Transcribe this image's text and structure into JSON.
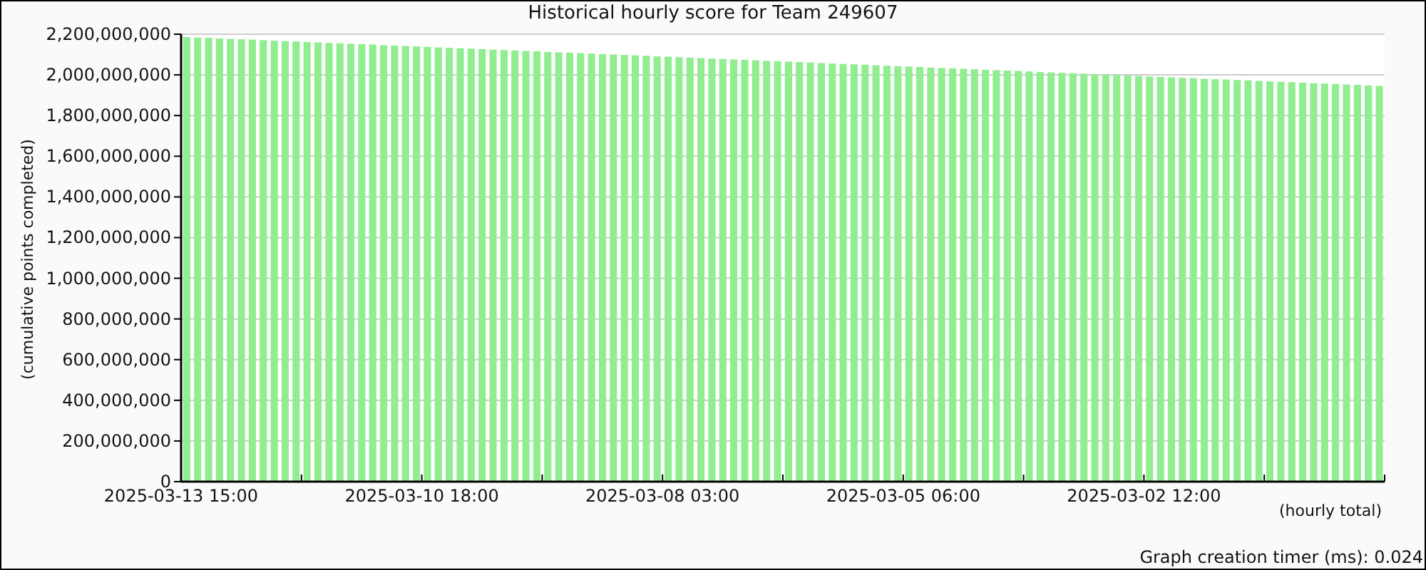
{
  "title": "Historical hourly score for Team 249607",
  "chart_data": {
    "type": "bar",
    "ylabel": "(cumulative points completed)",
    "xlabel": "(hourly total)",
    "ylim": [
      0,
      2200000000
    ],
    "yticks": [
      {
        "value": 0,
        "label": "0"
      },
      {
        "value": 200000000,
        "label": "200,000,000"
      },
      {
        "value": 400000000,
        "label": "400,000,000"
      },
      {
        "value": 600000000,
        "label": "600,000,000"
      },
      {
        "value": 800000000,
        "label": "800,000,000"
      },
      {
        "value": 1000000000,
        "label": "1,000,000,000"
      },
      {
        "value": 1200000000,
        "label": "1,200,000,000"
      },
      {
        "value": 1400000000,
        "label": "1,400,000,000"
      },
      {
        "value": 1600000000,
        "label": "1,600,000,000"
      },
      {
        "value": 1800000000,
        "label": "1,800,000,000"
      },
      {
        "value": 2000000000,
        "label": "2,000,000,000"
      },
      {
        "value": 2200000000,
        "label": "2,200,000,000"
      }
    ],
    "grid": true,
    "categories": [
      "2025-03-13 15:00",
      null,
      null,
      null,
      null,
      null,
      null,
      null,
      null,
      null,
      null,
      null,
      null,
      null,
      null,
      null,
      null,
      null,
      null,
      null,
      null,
      null,
      "2025-03-10 18:00",
      null,
      null,
      null,
      null,
      null,
      null,
      null,
      null,
      null,
      null,
      null,
      null,
      null,
      null,
      null,
      null,
      null,
      null,
      null,
      null,
      null,
      "2025-03-08 03:00",
      null,
      null,
      null,
      null,
      null,
      null,
      null,
      null,
      null,
      null,
      null,
      null,
      null,
      null,
      null,
      null,
      null,
      null,
      null,
      null,
      null,
      "2025-03-05 06:00",
      null,
      null,
      null,
      null,
      null,
      null,
      null,
      null,
      null,
      null,
      null,
      null,
      null,
      null,
      null,
      null,
      null,
      null,
      null,
      null,
      null,
      "2025-03-02 12:00",
      null,
      null,
      null,
      null,
      null,
      null,
      null,
      null,
      null,
      null,
      null,
      null,
      null,
      null,
      null,
      null,
      null,
      null,
      null,
      null,
      null
    ],
    "series": [
      {
        "color": "#90ee90",
        "values": [
          2186000000,
          2184000000,
          2182000000,
          2179000000,
          2177000000,
          2175000000,
          2173000000,
          2171000000,
          2168000000,
          2166000000,
          2164000000,
          2162000000,
          2160000000,
          2157000000,
          2155000000,
          2153000000,
          2151000000,
          2149000000,
          2146000000,
          2144000000,
          2142000000,
          2140000000,
          2138000000,
          2135000000,
          2133000000,
          2131000000,
          2129000000,
          2127000000,
          2124000000,
          2122000000,
          2120000000,
          2118000000,
          2116000000,
          2113000000,
          2111000000,
          2109000000,
          2107000000,
          2105000000,
          2102000000,
          2100000000,
          2098000000,
          2096000000,
          2094000000,
          2091000000,
          2089000000,
          2087000000,
          2085000000,
          2083000000,
          2080000000,
          2078000000,
          2076000000,
          2074000000,
          2072000000,
          2069000000,
          2067000000,
          2065000000,
          2063000000,
          2061000000,
          2058000000,
          2056000000,
          2054000000,
          2052000000,
          2050000000,
          2047000000,
          2045000000,
          2043000000,
          2041000000,
          2039000000,
          2036000000,
          2034000000,
          2032000000,
          2030000000,
          2028000000,
          2025000000,
          2023000000,
          2021000000,
          2019000000,
          2017000000,
          2014000000,
          2012000000,
          2010000000,
          2008000000,
          2006000000,
          2003000000,
          2001000000,
          1999000000,
          1997000000,
          1995000000,
          1992000000,
          1990000000,
          1988000000,
          1986000000,
          1984000000,
          1981000000,
          1979000000,
          1977000000,
          1975000000,
          1973000000,
          1970000000,
          1968000000,
          1966000000,
          1964000000,
          1962000000,
          1959000000,
          1957000000,
          1955000000,
          1953000000,
          1951000000,
          1948000000,
          1946000000
        ]
      }
    ]
  },
  "footer": "Graph creation timer (ms): 0.024"
}
